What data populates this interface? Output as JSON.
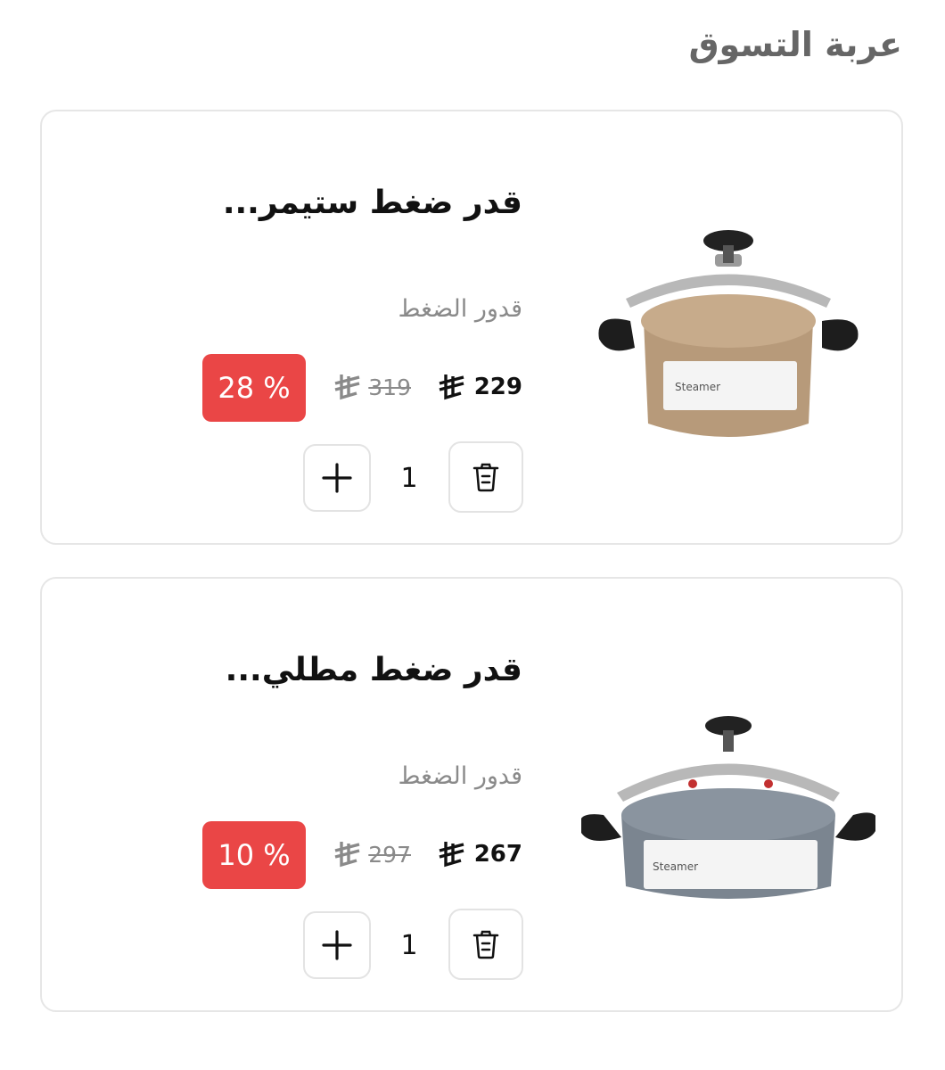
{
  "header": {
    "title": "عربة التسوق"
  },
  "cart": {
    "items": [
      {
        "title": "قدر ضغط ستيمر...",
        "category": "قدور الضغط",
        "price": "229",
        "old_price": "319",
        "discount": "% 28",
        "quantity": "1",
        "pot_color": "#b79a7a",
        "image_brand": "Steamer"
      },
      {
        "title": "قدر ضغط مطلي...",
        "category": "قدور الضغط",
        "price": "267",
        "old_price": "297",
        "discount": "% 10",
        "quantity": "1",
        "pot_color": "#7b8590",
        "image_brand": "Steamer"
      }
    ]
  },
  "colors": {
    "discount_bg": "#ea4646",
    "muted_text": "#8a8a8a"
  },
  "icons": {
    "currency": "riyal-icon",
    "delete": "trash-icon",
    "increase": "plus-icon"
  }
}
